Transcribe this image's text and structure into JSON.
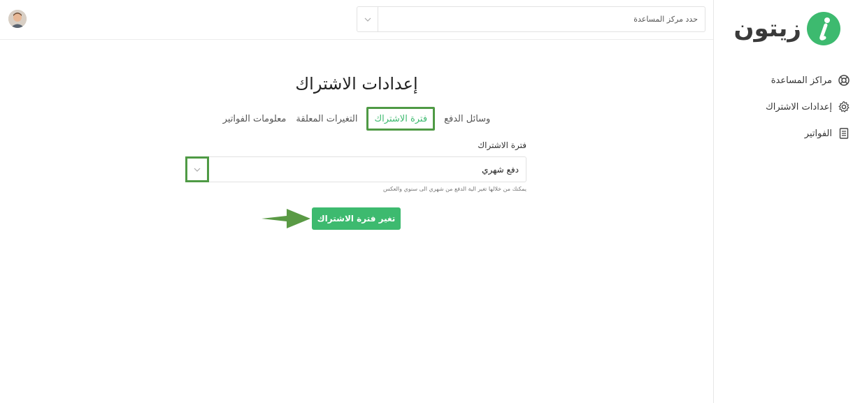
{
  "brand": {
    "name": "زيتون",
    "color": "#3dba6f"
  },
  "topbar": {
    "help_center_select": {
      "value": "حدد مركز المساعدة"
    }
  },
  "sidebar": {
    "items": [
      {
        "label": "مراكز المساعدة",
        "icon": "lifebuoy-icon"
      },
      {
        "label": "إعدادات الاشتراك",
        "icon": "gear-icon"
      },
      {
        "label": "الفواتير",
        "icon": "invoice-icon"
      }
    ]
  },
  "main": {
    "title": "إعدادات الاشتراك",
    "tabs": [
      {
        "label": "وسائل الدفع",
        "active": false
      },
      {
        "label": "فترة الاشتراك",
        "active": true
      },
      {
        "label": "التغيرات المعلقة",
        "active": false
      },
      {
        "label": "معلومات الفواتير",
        "active": false
      }
    ],
    "period_field": {
      "label": "فترة الاشتراك",
      "value": "دفع شهري",
      "help": "يمكنك من خلالها تغير الية الدفع من شهري الى سنوي والعكس"
    },
    "submit_label": "تغير فترة الاشتراك"
  },
  "colors": {
    "accent": "#3dba6f",
    "highlight": "#4f9a45"
  }
}
